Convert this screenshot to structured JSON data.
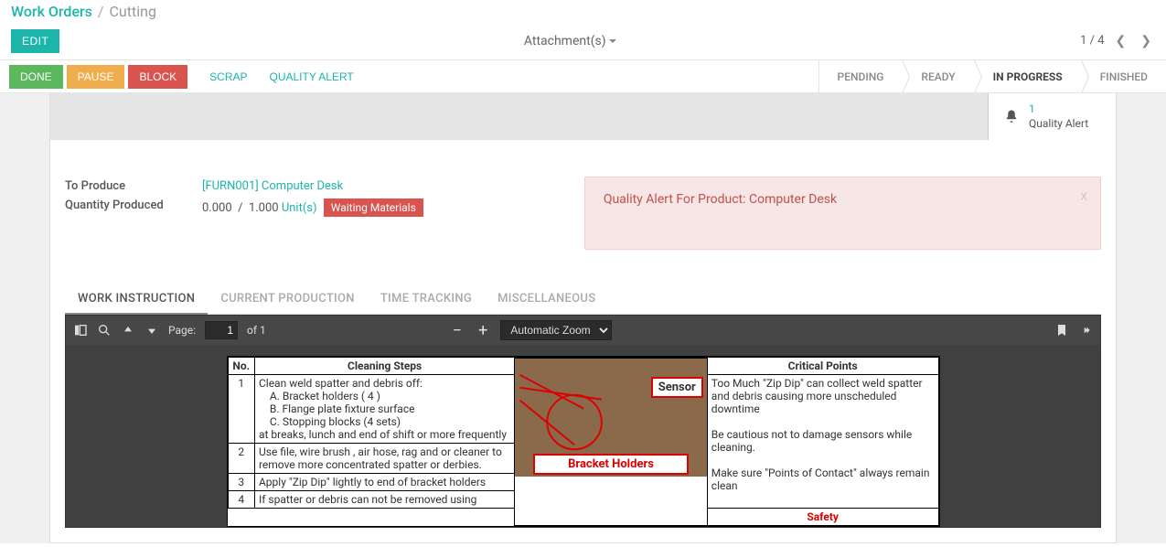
{
  "breadcrumb": {
    "root": "Work Orders",
    "sep": "/",
    "current": "Cutting"
  },
  "buttons": {
    "edit": "EDIT",
    "done": "DONE",
    "pause": "PAUSE",
    "block": "BLOCK",
    "scrap": "SCRAP",
    "quality_alert": "QUALITY ALERT"
  },
  "attachments": {
    "label": "Attachment(s)"
  },
  "pager": {
    "pos": "1 / 4"
  },
  "stages": {
    "pending": "PENDING",
    "ready": "READY",
    "in_progress": "IN PROGRESS",
    "finished": "FINISHED"
  },
  "sheet_alert": {
    "count": "1",
    "label": "Quality Alert"
  },
  "form": {
    "to_produce_label": "To Produce",
    "to_produce_value": "[FURN001] Computer Desk",
    "qty_label": "Quantity Produced",
    "qty_done": "0.000",
    "qty_sep": "/",
    "qty_total": "1.000",
    "qty_unit": "Unit(s)",
    "wait_badge": "Waiting Materials"
  },
  "qalert": {
    "text": "Quality Alert For Product: Computer Desk",
    "close": "x"
  },
  "tabs": {
    "work_instruction": "WORK INSTRUCTION",
    "current_production": "CURRENT PRODUCTION",
    "time_tracking": "TIME TRACKING",
    "misc": "MISCELLANEOUS"
  },
  "pdf": {
    "page_label": "Page:",
    "page_value": "1",
    "page_of": "of 1",
    "zoom_label": "Automatic Zoom",
    "doc": {
      "col_no": "No.",
      "col_steps": "Cleaning Steps",
      "col_crit": "Critical Points",
      "r1_no": "1",
      "r1_head": "Clean weld spatter and debris off:",
      "r1_a": "A. Bracket holders ( 4 )",
      "r1_b": "B. Flange plate fixture surface",
      "r1_c": "C. Stopping blocks (4 sets)",
      "r1_tail": "at breaks, lunch and end of shift or more frequently",
      "r2_no": "2",
      "r2": "Use file, wire brush , air hose, rag and or cleaner to remove more concentrated spatter or derbies.",
      "r3_no": "3",
      "r3": "Apply \"Zip Dip\" lightly to end of bracket holders",
      "r4_no": "4",
      "r4": "If spatter or debris can not be removed using",
      "crit1": "Too Much \"Zip Dip\" can collect weld spatter and debris causing more unscheduled downtime",
      "crit2": "Be cautious not to damage sensors while cleaning.",
      "crit3": "Make sure \"Points of Contact\" always remain clean",
      "sensor": "Sensor",
      "bracket": "Bracket Holders",
      "safety": "Safety"
    }
  }
}
